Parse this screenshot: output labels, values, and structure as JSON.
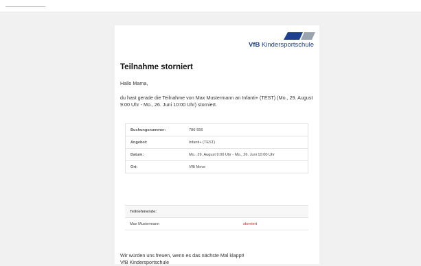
{
  "brand": {
    "logo_text_bold": "VfB",
    "logo_text": " Kindersportschule",
    "color": "#1d3f8f"
  },
  "email": {
    "heading": "Teilnahme storniert",
    "greeting": "Hallo Mama,",
    "message": "du hast gerade die Teilnahme von Max Mustermann an Infanti+ (TEST) (Mo., 29. August 9:00 Uhr - Mo., 26. Juni 10:00 Uhr) storniert.",
    "details": [
      {
        "label": "Buchungsnummer:",
        "value": "786-556"
      },
      {
        "label": "Angebot:",
        "value": "Infanti+ (TEST)"
      },
      {
        "label": "Datum:",
        "value": "Mo., 29. August 9:00 Uhr - Mo., 26. Juni 10:00 Uhr"
      },
      {
        "label": "Ort:",
        "value": "VfB Move"
      }
    ],
    "participants_header": "Teilnehmende:",
    "participants": [
      {
        "name": "Max Mustermann",
        "status": "storniert",
        "status_color": "#c0231c"
      }
    ],
    "closing": "Wir würden uns freuen, wenn es das nächste Mal klappt!",
    "signature": "VfB Kindersportschule"
  }
}
